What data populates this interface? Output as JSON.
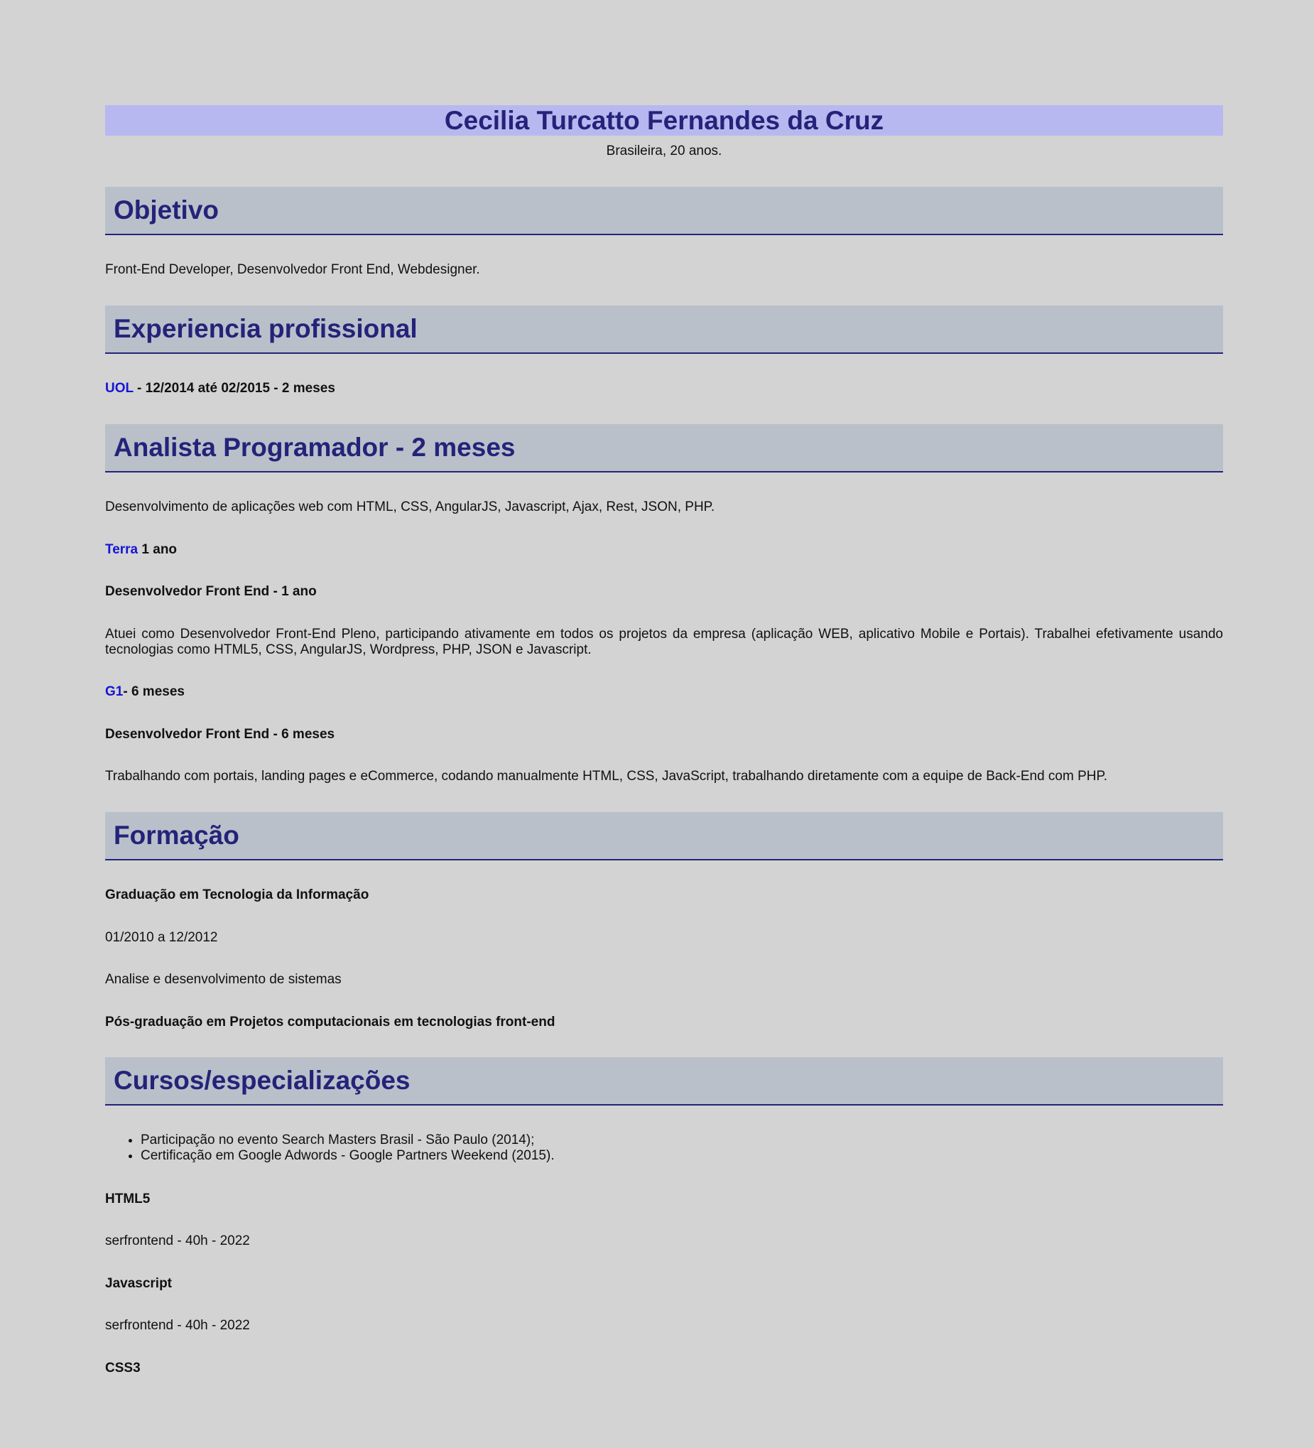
{
  "header": {
    "name": "Cecilia Turcatto Fernandes da Cruz",
    "subtitle": "Brasileira, 20 anos."
  },
  "objective": {
    "title": "Objetivo",
    "text": "Front-End Developer, Desenvolvedor Front End, Webdesigner."
  },
  "experience": {
    "title": "Experiencia profissional",
    "uol": {
      "company": "UOL",
      "detail": " - 12/2014 até 02/2015 - 2 meses"
    },
    "role_header": "Analista Programador - 2 meses",
    "role_text": "Desenvolvimento de aplicações web com HTML, CSS, AngularJS, Javascript, Ajax, Rest, JSON, PHP.",
    "terra": {
      "company": "Terra",
      "detail": " 1 ano",
      "role": "Desenvolvedor Front End - 1 ano",
      "text": "Atuei como Desenvolvedor Front-End Pleno, participando ativamente em todos os projetos da empresa (aplicação WEB, aplicativo Mobile e Portais). Trabalhei efetivamente usando tecnologias como HTML5, CSS, AngularJS, Wordpress, PHP, JSON e Javascript."
    },
    "g1": {
      "company": "G1",
      "detail": "- 6 meses",
      "role": "Desenvolvedor Front End - 6 meses",
      "text": "Trabalhando com portais, landing pages e eCommerce, codando manualmente HTML, CSS, JavaScript, trabalhando diretamente com a equipe de Back-End com PHP."
    }
  },
  "education": {
    "title": "Formação",
    "degree": "Graduação em Tecnologia da Informação",
    "period": "01/2010 a 12/2012",
    "course": "Analise e desenvolvimento de sistemas",
    "postgrad": "Pós-graduação em Projetos computacionais em tecnologias front-end"
  },
  "courses": {
    "title": "Cursos/especializações",
    "items": [
      "Participação no evento Search Masters Brasil - São Paulo (2014);",
      "Certificação em Google Adwords - Google Partners Weekend (2015)."
    ],
    "html5": "HTML5",
    "html5_detail": "serfrontend - 40h - 2022",
    "javascript": "Javascript",
    "javascript_detail": "serfrontend - 40h - 2022",
    "css3": "CSS3"
  },
  "colors": {
    "background": "#d3d3d3",
    "name_bar": "#b8b8f0",
    "section_bar": "#b9c0c9",
    "heading_text": "#24237a",
    "link": "#1515d6"
  }
}
